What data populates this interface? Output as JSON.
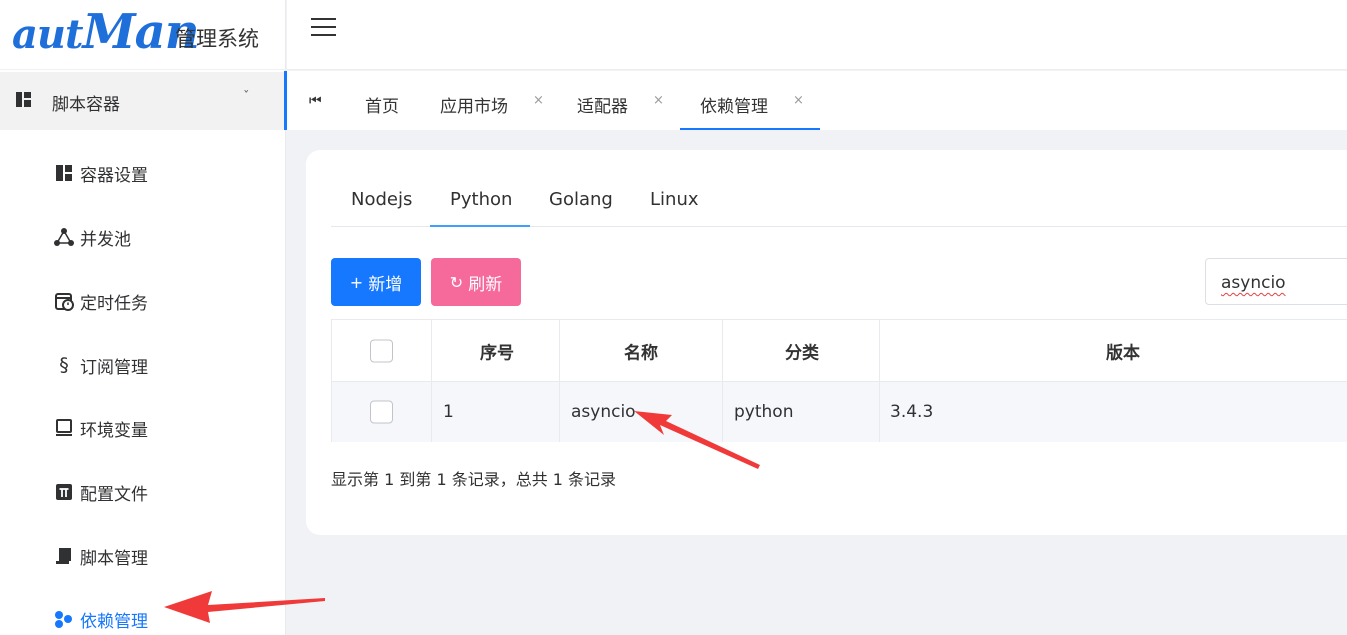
{
  "logo": {
    "script_a": "aut",
    "script_b": "Man",
    "system_name": "管理系统"
  },
  "sidebar": {
    "group": {
      "label": "脚本容器",
      "arrow": "ˇ"
    },
    "items": [
      {
        "label": "容器设置",
        "icon": "dashboard-icon",
        "glyph": "▙"
      },
      {
        "label": "并发池",
        "icon": "share-nodes-icon",
        "glyph": "⁂"
      },
      {
        "label": "定时任务",
        "icon": "calendar-clock-icon",
        "glyph": "▣"
      },
      {
        "label": "订阅管理",
        "icon": "section-icon",
        "glyph": "§"
      },
      {
        "label": "环境变量",
        "icon": "monitor-icon",
        "glyph": "▭"
      },
      {
        "label": "配置文件",
        "icon": "pi-icon",
        "glyph": "π"
      },
      {
        "label": "脚本管理",
        "icon": "scroll-icon",
        "glyph": "▤"
      },
      {
        "label": "依赖管理",
        "icon": "cubes-icon",
        "glyph": "●",
        "active": true
      }
    ]
  },
  "tabs": {
    "first_icon": "⏮",
    "items": [
      {
        "label": "首页",
        "closable": false
      },
      {
        "label": "应用市场",
        "closable": true
      },
      {
        "label": "适配器",
        "closable": true
      },
      {
        "label": "依赖管理",
        "closable": true,
        "active": true
      }
    ],
    "close_glyph": "×"
  },
  "subtabs": [
    "Nodejs",
    "Python",
    "Golang",
    "Linux"
  ],
  "active_subtab": "Python",
  "toolbar": {
    "add_label": "新增",
    "add_icon": "+",
    "refresh_label": "刷新",
    "refresh_icon": "↻"
  },
  "search": {
    "value": "asyncio"
  },
  "table": {
    "headers": [
      "序号",
      "名称",
      "分类",
      "版本"
    ],
    "rows": [
      {
        "index": "1",
        "name": "asyncio",
        "category": "python",
        "version": "3.4.3"
      }
    ]
  },
  "footer": {
    "summary": "显示第 1 到第 1 条记录，总共 1 条记录"
  },
  "colors": {
    "primary": "#1677ff",
    "refresh": "#f5699b",
    "annotation_arrow": "#f03a3a"
  }
}
